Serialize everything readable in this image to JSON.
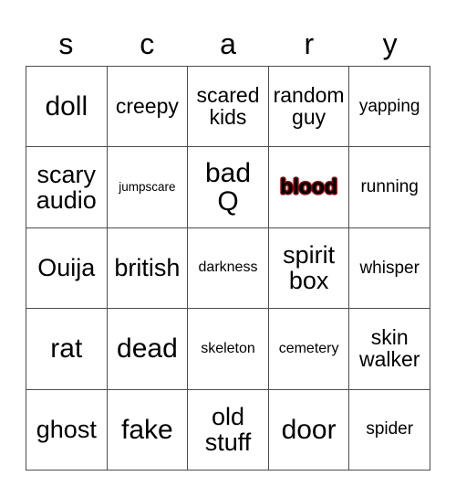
{
  "card": {
    "title_letters": [
      "s",
      "c",
      "a",
      "r",
      "y"
    ],
    "columns": 5,
    "rows": 5,
    "background_color": "#ffffff",
    "grid_line_color": "#4d4d4d",
    "text_color": "#000000"
  },
  "cells": [
    {
      "text": "doll",
      "size": "fs-xl",
      "style": "plain"
    },
    {
      "text": "creepy",
      "size": "fs-md",
      "style": "plain"
    },
    {
      "text": "scared\nkids",
      "size": "fs-md",
      "style": "plain"
    },
    {
      "text": "random\nguy",
      "size": "fs-md",
      "style": "plain"
    },
    {
      "text": "yapping",
      "size": "fs-sm",
      "style": "plain"
    },
    {
      "text": "scary\naudio",
      "size": "fs-lg",
      "style": "plain"
    },
    {
      "text": "jumpscare",
      "size": "fs-xxs",
      "style": "plain"
    },
    {
      "text": "bad\nQ",
      "size": "fs-xl",
      "style": "plain"
    },
    {
      "text": "blood",
      "size": "fs-md",
      "style": "blood"
    },
    {
      "text": "running",
      "size": "fs-sm",
      "style": "plain"
    },
    {
      "text": "Ouija",
      "size": "fs-lg",
      "style": "plain"
    },
    {
      "text": "british",
      "size": "fs-lg",
      "style": "plain"
    },
    {
      "text": "darkness",
      "size": "fs-xs",
      "style": "plain"
    },
    {
      "text": "spirit\nbox",
      "size": "fs-lg",
      "style": "plain"
    },
    {
      "text": "whisper",
      "size": "fs-sm",
      "style": "plain"
    },
    {
      "text": "rat",
      "size": "fs-xl",
      "style": "plain"
    },
    {
      "text": "dead",
      "size": "fs-xl",
      "style": "plain"
    },
    {
      "text": "skeleton",
      "size": "fs-xs",
      "style": "plain"
    },
    {
      "text": "cemetery",
      "size": "fs-xs",
      "style": "plain"
    },
    {
      "text": "skin\nwalker",
      "size": "fs-md",
      "style": "plain"
    },
    {
      "text": "ghost",
      "size": "fs-lg",
      "style": "plain"
    },
    {
      "text": "fake",
      "size": "fs-xl",
      "style": "plain"
    },
    {
      "text": "old\nstuff",
      "size": "fs-lg",
      "style": "plain"
    },
    {
      "text": "door",
      "size": "fs-xl",
      "style": "plain"
    },
    {
      "text": "spider",
      "size": "fs-sm",
      "style": "plain"
    }
  ]
}
